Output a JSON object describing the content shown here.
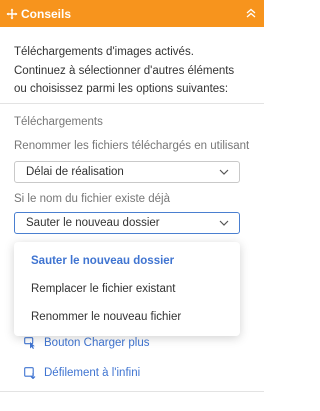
{
  "header": {
    "title": "Conseils",
    "icon": "move-icon",
    "collapse_icon": "double-chevron-up-icon",
    "color": "#f7941d"
  },
  "intro": {
    "line1": "Téléchargements d'images activés.",
    "line2": "Continuez à sélectionner d'autres éléments",
    "line3": "ou choisissez parmi les options suivantes:"
  },
  "downloads": {
    "section_title": "Téléchargements",
    "rename_label": "Renommer les fichiers téléchargés en utilisant",
    "rename_value": "Délai de réalisation",
    "exists_label": "Si le nom du fichier existe déjà",
    "exists_value": "Sauter le nouveau dossier"
  },
  "dropdown": {
    "options": [
      "Sauter le nouveau dossier",
      "Remplacer le fichier existant",
      "Renommer le nouveau fichier"
    ],
    "selected": "Sauter le nouveau dossier"
  },
  "links": {
    "load_more": "Bouton Charger plus",
    "infinite_scroll": "Défilement à l'infini"
  },
  "colors": {
    "accent": "#3f74d1",
    "header": "#f7941d"
  }
}
